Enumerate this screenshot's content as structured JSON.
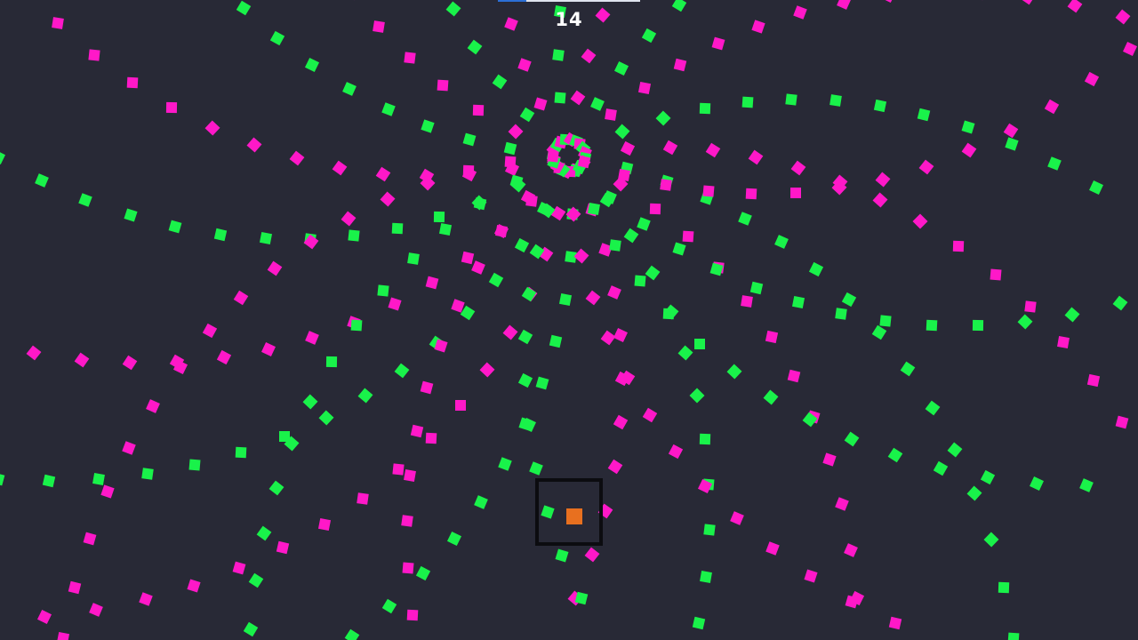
{
  "hud": {
    "score": "14",
    "wave_progress": 0.2
  },
  "colors": {
    "background": "#282936",
    "bullet_green": "#19f24a",
    "bullet_magenta": "#ff18c8",
    "player_frame": "#0c0c10",
    "player_core": "#e8701f",
    "progress_accent": "#2c6fd6"
  },
  "bullet_types": [
    "green-square",
    "magenta-square"
  ]
}
